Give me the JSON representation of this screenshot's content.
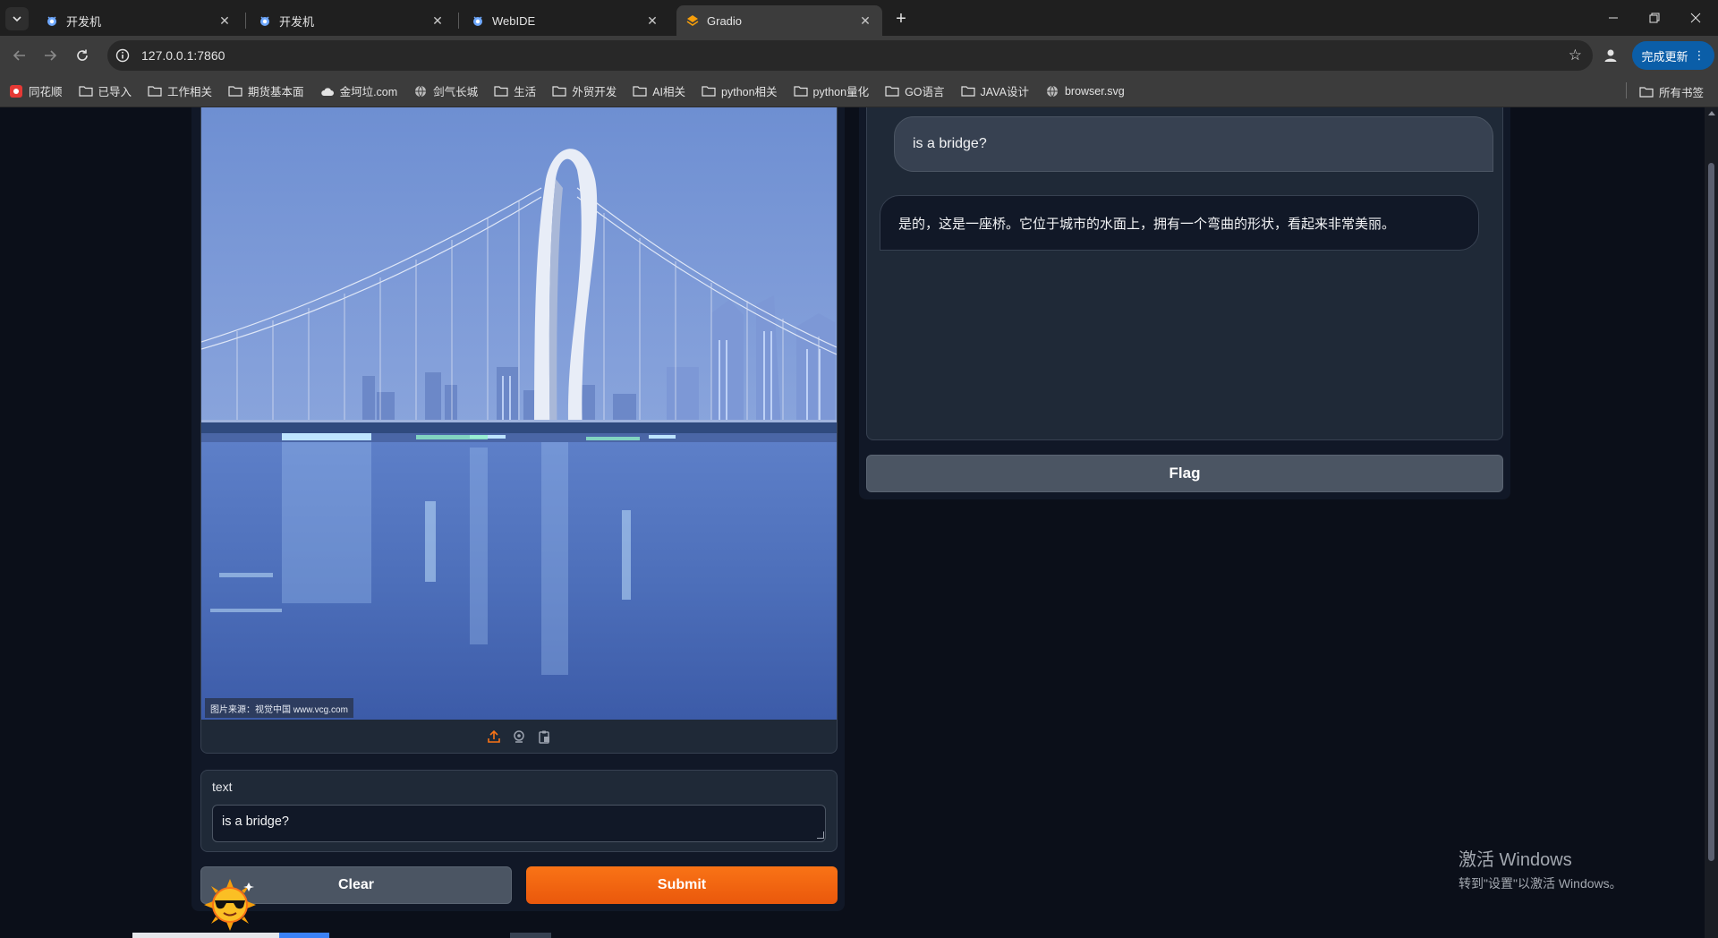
{
  "browser": {
    "tabs": [
      {
        "title": "开发机",
        "active": false
      },
      {
        "title": "开发机",
        "active": false
      },
      {
        "title": "WebIDE",
        "active": false
      },
      {
        "title": "Gradio",
        "active": true
      }
    ],
    "new_tab_symbol": "+",
    "url": "127.0.0.1:7860",
    "update_button": "完成更新",
    "bookmarks": [
      {
        "label": "同花顺",
        "icon": "app-icon"
      },
      {
        "label": "已导入",
        "icon": "folder-icon"
      },
      {
        "label": "工作相关",
        "icon": "folder-icon"
      },
      {
        "label": "期货基本面",
        "icon": "folder-icon"
      },
      {
        "label": "金坷垃.com",
        "icon": "cloud-icon"
      },
      {
        "label": "剑气长城",
        "icon": "globe-icon"
      },
      {
        "label": "生活",
        "icon": "folder-icon"
      },
      {
        "label": "外贸开发",
        "icon": "folder-icon"
      },
      {
        "label": "AI相关",
        "icon": "folder-icon"
      },
      {
        "label": "python相关",
        "icon": "folder-icon"
      },
      {
        "label": "python量化",
        "icon": "folder-icon"
      },
      {
        "label": "GO语言",
        "icon": "folder-icon"
      },
      {
        "label": "JAVA设计",
        "icon": "folder-icon"
      },
      {
        "label": "browser.svg",
        "icon": "globe-icon"
      }
    ],
    "all_bookmarks": "所有书签"
  },
  "inputs": {
    "image_credit": "图片来源：视觉中国 www.vcg.com",
    "text_label": "text",
    "text_value": "is a bridge?",
    "clear_button": "Clear",
    "submit_button": "Submit"
  },
  "chat": {
    "user_message": "is a bridge?",
    "bot_message": "是的，这是一座桥。它位于城市的水面上，拥有一个弯曲的形状，看起来非常美丽。",
    "flag_button": "Flag"
  },
  "watermark": {
    "line1": "激活 Windows",
    "line2": "转到\"设置\"以激活 Windows。"
  },
  "colors": {
    "page_bg": "#0b0f19",
    "panel_bg": "#1f2937",
    "submit_orange": "#f97316",
    "secondary_btn": "#4b5563",
    "update_btn": "#0b5ea8"
  }
}
